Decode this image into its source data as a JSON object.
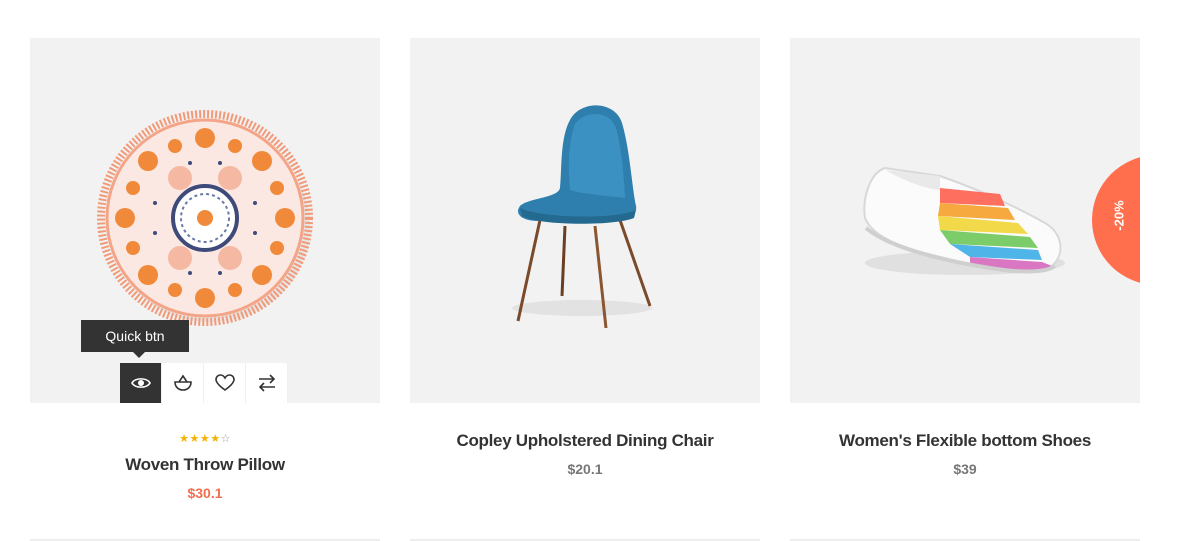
{
  "products": [
    {
      "title": "Woven Throw Pillow",
      "price": "$30.1",
      "rating_stars": 4,
      "rating_max": 5,
      "tooltip": "Quick btn",
      "actions": [
        "eye-icon",
        "basket-icon",
        "heart-icon",
        "compare-arrows-icon"
      ],
      "price_color": "#ef6f4f"
    },
    {
      "title": "Copley Upholstered Dining Chair",
      "price": "$20.1"
    },
    {
      "title": "Women's Flexible bottom Shoes",
      "price": "$39",
      "badge": "-20%",
      "badge_color": "#ff6f4d"
    }
  ],
  "colors": {
    "thumb_bg": "#f2f2f2",
    "title": "#333333",
    "star": "#f0b400"
  }
}
